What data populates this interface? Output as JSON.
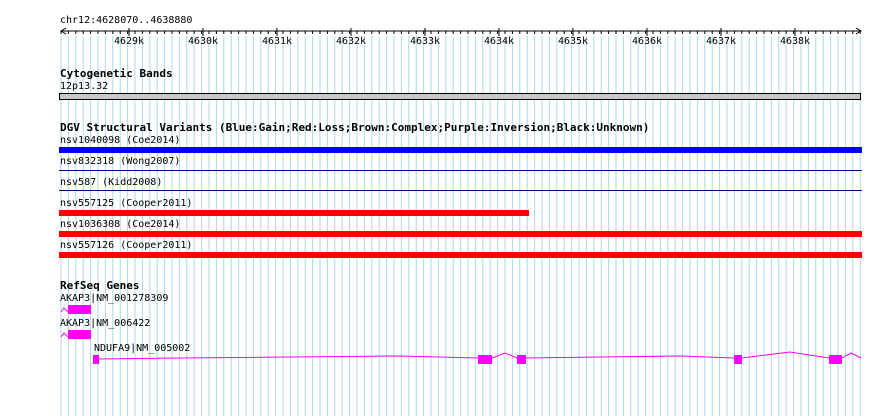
{
  "ruler": {
    "region_label": "chr12:4628070..4638880",
    "ticks": [
      "4629k",
      "4630k",
      "4631k",
      "4632k",
      "4633k",
      "4634k",
      "4635k",
      "4636k",
      "4637k",
      "4638k"
    ]
  },
  "tracks": {
    "cytoband": {
      "title": "Cytogenetic Bands",
      "band_label": "12p13.32"
    },
    "dgv": {
      "title": "DGV Structural Variants (Blue:Gain;Red:Loss;Brown:Complex;Purple:Inversion;Black:Unknown)",
      "features": [
        {
          "label": "nsv1040098 (Coe2014)",
          "color": "#0000ff",
          "type": "Gain"
        },
        {
          "label": "nsv832318 (Wong2007)",
          "color": "#000080",
          "type": "Gain"
        },
        {
          "label": "nsv587 (Kidd2008)",
          "color": "#000080",
          "type": "Gain"
        },
        {
          "label": "nsv557125 (Cooper2011)",
          "color": "#ff0000",
          "type": "Loss"
        },
        {
          "label": "nsv1036308 (Coe2014)",
          "color": "#ff0000",
          "type": "Loss"
        },
        {
          "label": "nsv557126 (Cooper2011)",
          "color": "#ff0000",
          "type": "Loss"
        }
      ]
    },
    "refseq": {
      "title": "RefSeq Genes",
      "genes": [
        {
          "label": "AKAP3|NM_001278309",
          "color": "#ff00ff"
        },
        {
          "label": "AKAP3|NM_006422",
          "color": "#ff00ff"
        },
        {
          "label": "NDUFA9|NM_005002",
          "color": "#ff00ff"
        }
      ]
    }
  },
  "colors": {
    "grid": "#add8e6",
    "gain": "#0000ff",
    "loss": "#ff0000",
    "gene": "#ff00ff",
    "band": "#c8c8c8"
  }
}
